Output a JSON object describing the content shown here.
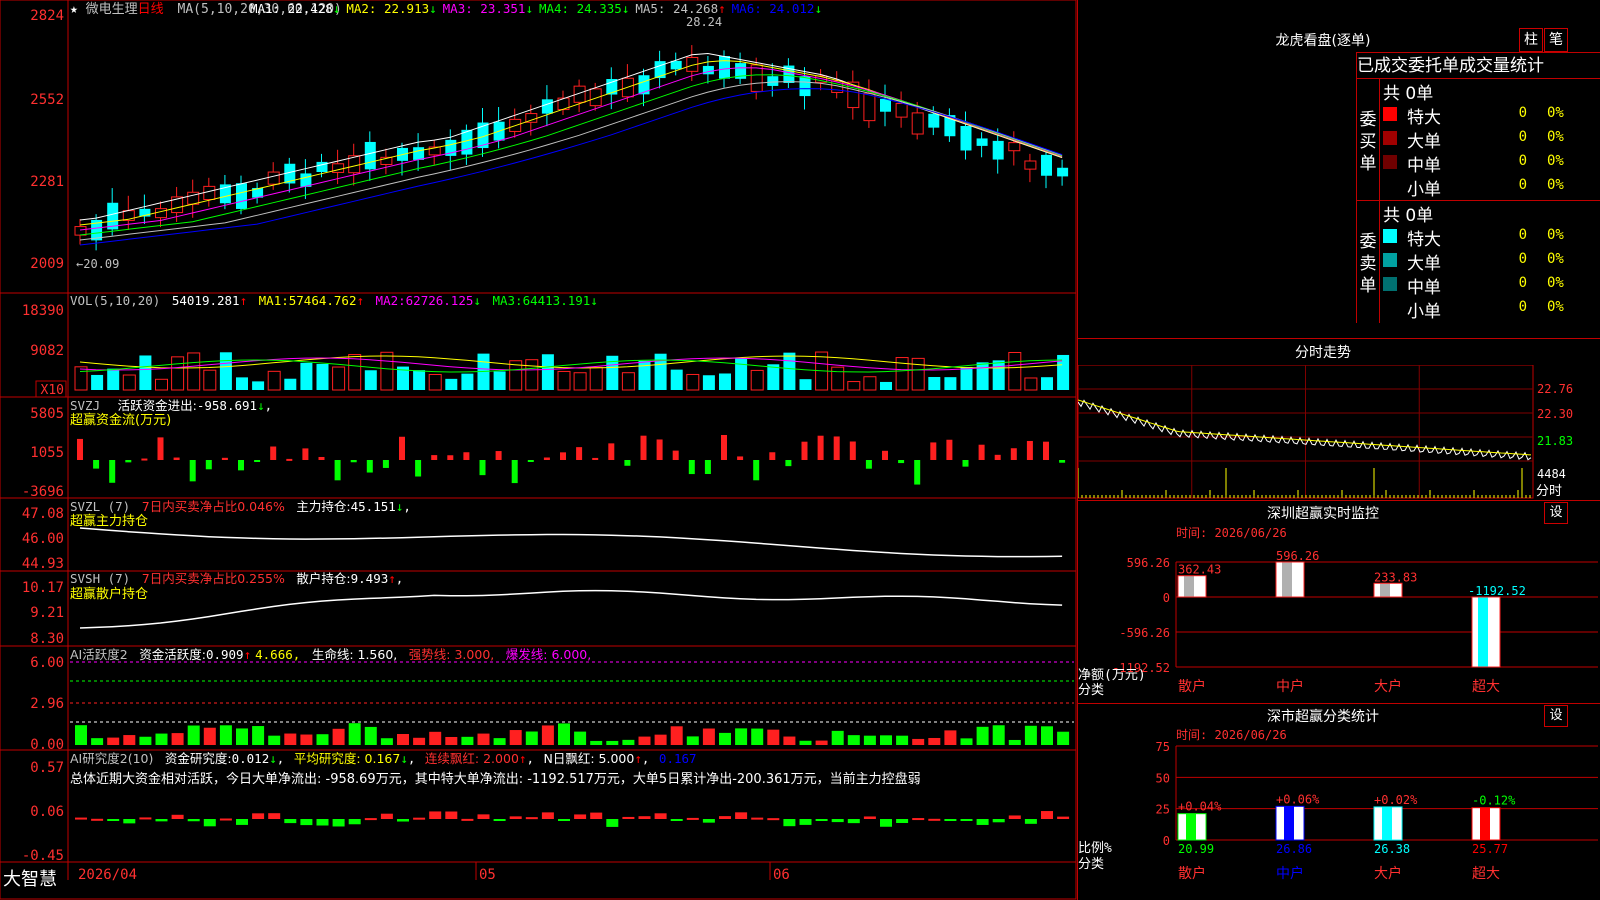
{
  "stock": {
    "name": "微电生理",
    "period": "日线"
  },
  "ma_header": {
    "params": "MA(5,10,20,30,60,120)",
    "items": [
      {
        "label": "MA1:",
        "value": "22.428",
        "arrow": "↓",
        "color": "#ffffff"
      },
      {
        "label": "MA2:",
        "value": "22.913",
        "arrow": "↓",
        "color": "#ffff00"
      },
      {
        "label": "MA3:",
        "value": "23.351",
        "arrow": "↓",
        "color": "#ff00ff"
      },
      {
        "label": "MA4:",
        "value": "24.335",
        "arrow": "↓",
        "color": "#00ff00"
      },
      {
        "label": "MA5:",
        "value": "24.268",
        "arrow": "↑",
        "color": "#c0c0c0"
      },
      {
        "label": "MA6:",
        "value": "24.012",
        "arrow": "↓",
        "color": "#0000ff"
      }
    ]
  },
  "price_axis": [
    "2824",
    "2552",
    "2281",
    "2009"
  ],
  "price_annotations": {
    "high": "28.24",
    "low": "←20.09"
  },
  "vol_header": {
    "params": "VOL(5,10,20)",
    "value": "54019.281",
    "ma1": "57464.762",
    "ma2": "62726.125",
    "ma3": "64413.191"
  },
  "vol_axis": [
    "18390",
    "9082",
    "X10"
  ],
  "svzj": {
    "title": "SVZJ",
    "label": "活跃资金进出:",
    "value": "-958.691",
    "subtitle": "超赢资金流(万元)",
    "axis": [
      "5805",
      "1055",
      "-3696"
    ]
  },
  "svzl": {
    "title": "SVZL (7)",
    "ratio": "7日内买卖净占比0.046%",
    "label": "主力持仓:",
    "value": "45.151",
    "subtitle": "超赢主力持仓",
    "axis": [
      "47.08",
      "46.00",
      "44.93"
    ]
  },
  "svsh": {
    "title": "SVSH (7)",
    "ratio": "7日内买卖净占比0.255%",
    "label": "散户持仓:",
    "value": "9.493",
    "subtitle": "超赢散户持仓",
    "axis": [
      "10.17",
      "9.21",
      "8.30"
    ]
  },
  "ai_act": {
    "title": "AI活跃度2",
    "label": "资金活跃度:",
    "value": "0.909",
    "v2": "4.666,",
    "life": "生命线: 1.560,",
    "strong": "强势线: 3.000,",
    "burst": "爆发线: 6.000,",
    "axis": [
      "6.00",
      "2.96",
      "0.00"
    ]
  },
  "ai_res": {
    "title": "AI研究度2(10)",
    "label": "资金研究度:",
    "value": "0.012",
    "avg": "平均研究度: 0.167",
    "red": "连续飘红: 2.000",
    "nred": "N日飘红: 5.000",
    "last": "0.167",
    "text": "总体近期大资金相对活跃，今日大单净流出: -958.69万元，其中特大单净流出: -1192.517万元，大单5日累计净出-200.361万元，当前主力控盘弱",
    "axis": [
      "0.57",
      "0.06",
      "-0.45"
    ]
  },
  "date_axis": [
    "2026/04",
    "05",
    "06"
  ],
  "brand": "大智慧",
  "longhu": {
    "title": "龙虎看盘(逐单)",
    "btn1": "柱",
    "btn2": "笔",
    "header": "已成交委托单成交量统计",
    "buy": {
      "side": "委买单",
      "total": "共 0单",
      "rows": [
        {
          "label": "特大",
          "val": "0",
          "pct": "0%",
          "color": "#ff0000"
        },
        {
          "label": "大单",
          "val": "0",
          "pct": "0%",
          "color": "#a00000"
        },
        {
          "label": "中单",
          "val": "0",
          "pct": "0%",
          "color": "#700000"
        },
        {
          "label": "小单",
          "val": "0",
          "pct": "0%",
          "color": "#000000"
        }
      ]
    },
    "sell": {
      "side": "委卖单",
      "total": "共 0单",
      "rows": [
        {
          "label": "特大",
          "val": "0",
          "pct": "0%",
          "color": "#00ffff"
        },
        {
          "label": "大单",
          "val": "0",
          "pct": "0%",
          "color": "#00a0a0"
        },
        {
          "label": "中单",
          "val": "0",
          "pct": "0%",
          "color": "#007070"
        },
        {
          "label": "小单",
          "val": "0",
          "pct": "0%",
          "color": "#000000"
        }
      ]
    }
  },
  "intraday": {
    "title": "分时走势",
    "axis": [
      "22.76",
      "22.30",
      "21.83",
      "4484"
    ],
    "unit": "分时"
  },
  "sz_monitor": {
    "title": "深圳超赢实时监控",
    "btn": "设",
    "time": "时间: 2026/06/26",
    "axis": [
      "596.26",
      "0",
      "-596.26",
      "-1192.52"
    ],
    "ylabel": "净额(万元)",
    "xlabel": "分类",
    "bars": [
      {
        "cat": "散户",
        "value": 362.43,
        "label": "362.43"
      },
      {
        "cat": "中户",
        "value": 596.26,
        "label": "596.26"
      },
      {
        "cat": "大户",
        "value": 233.83,
        "label": "233.83"
      },
      {
        "cat": "超大",
        "value": -1192.52,
        "label": "-1192.52"
      }
    ]
  },
  "sz_classify": {
    "title": "深市超赢分类统计",
    "btn": "设",
    "time": "时间: 2026/06/26",
    "axis": [
      "75",
      "50",
      "25",
      "0"
    ],
    "ylabel": "比例%",
    "xlabel": "分类",
    "bars": [
      {
        "cat": "散户",
        "value": 20.99,
        "label": "20.99",
        "chg": "+0.04%",
        "color": "#00ff00"
      },
      {
        "cat": "中户",
        "value": 26.86,
        "label": "26.86",
        "chg": "+0.06%",
        "color": "#0000ff"
      },
      {
        "cat": "大户",
        "value": 26.38,
        "label": "26.38",
        "chg": "+0.02%",
        "color": "#00ffff"
      },
      {
        "cat": "超大",
        "value": 25.77,
        "label": "25.77",
        "chg": "-0.12%",
        "color": "#ff0000"
      }
    ]
  },
  "chart_data": {
    "type": "bar",
    "title": "深市超赢分类统计",
    "categories": [
      "散户",
      "中户",
      "大户",
      "超大"
    ],
    "series": [
      {
        "name": "净额(万元)",
        "values": [
          362.43,
          596.26,
          233.83,
          -1192.52
        ]
      },
      {
        "name": "比例%",
        "values": [
          20.99,
          26.86,
          26.38,
          25.77
        ]
      }
    ],
    "ylabel": "净额(万元)"
  }
}
